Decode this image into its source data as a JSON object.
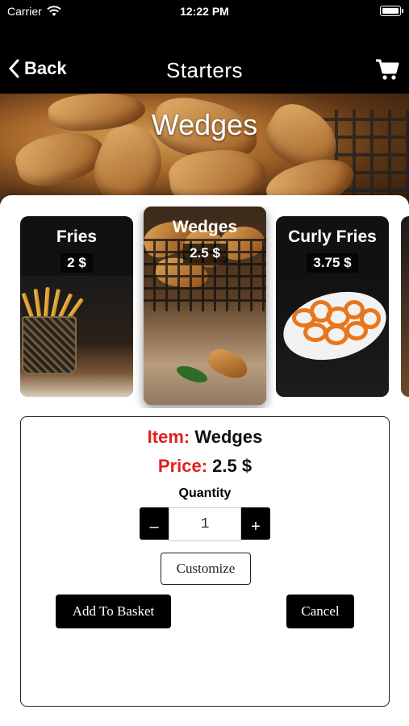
{
  "status_bar": {
    "carrier": "Carrier",
    "time": "12:22 PM"
  },
  "nav": {
    "back_label": "Back",
    "title": "Starters"
  },
  "hero": {
    "title": "Wedges"
  },
  "carousel": {
    "items": [
      {
        "name": "Fries",
        "price": "2 $"
      },
      {
        "name": "Wedges",
        "price": "2.5 $"
      },
      {
        "name": "Curly Fries",
        "price": "3.75 $"
      }
    ],
    "selected_index": 1
  },
  "detail": {
    "item_label": "Item:",
    "item_value": "Wedges",
    "price_label": "Price:",
    "price_value": "2.5 $",
    "quantity_label": "Quantity",
    "quantity_value": "1",
    "minus_label": "–",
    "plus_label": "+",
    "customize_label": "Customize",
    "add_label": "Add To Basket",
    "cancel_label": "Cancel"
  },
  "colors": {
    "accent_red": "#e02020",
    "bar_black": "#000000"
  },
  "icons": [
    "wifi-icon",
    "battery-icon",
    "back-chevron-icon",
    "cart-icon"
  ]
}
